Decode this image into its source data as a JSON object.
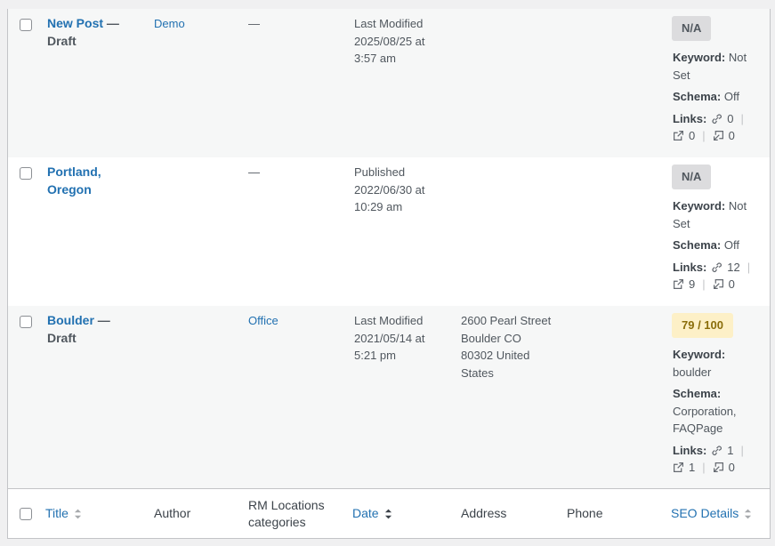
{
  "rows": [
    {
      "title": "New Post",
      "state": "Draft",
      "author": "Demo",
      "categories": "—",
      "date_line1": "Last Modified",
      "date_line2": "2025/08/25 at",
      "date_line3": "3:57 am",
      "address": [
        "",
        "",
        "",
        ""
      ],
      "phone": "",
      "seo_badge": "N/A",
      "keyword_label": "Keyword:",
      "keyword_value": "Not Set",
      "schema_label": "Schema:",
      "schema_value": "Off",
      "links_label": "Links:",
      "links_internal": "0",
      "links_external": "0",
      "links_incoming": "0"
    },
    {
      "title": "Portland, Oregon",
      "state": "",
      "author": "",
      "categories": "—",
      "date_line1": "Published",
      "date_line2": "2022/06/30 at",
      "date_line3": "10:29 am",
      "address": [
        "",
        "",
        "",
        ""
      ],
      "phone": "",
      "seo_badge": "N/A",
      "keyword_label": "Keyword:",
      "keyword_value": "Not Set",
      "schema_label": "Schema:",
      "schema_value": "Off",
      "links_label": "Links:",
      "links_internal": "12",
      "links_external": "9",
      "links_incoming": "0"
    },
    {
      "title": "Boulder",
      "state": "Draft",
      "author": "",
      "categories": "Office",
      "date_line1": "Last Modified",
      "date_line2": "2021/05/14 at",
      "date_line3": "5:21 pm",
      "address": [
        "2600 Pearl Street",
        "Boulder CO",
        "80302 United",
        "States"
      ],
      "phone": "",
      "seo_badge": "79 / 100",
      "keyword_label": "Keyword:",
      "keyword_value": "boulder",
      "schema_label": "Schema:",
      "schema_value": "Corporation, FAQPage",
      "links_label": "Links:",
      "links_internal": "1",
      "links_external": "1",
      "links_incoming": "0"
    }
  ],
  "footer": {
    "title": "Title",
    "author": "Author",
    "categories": "RM Locations categories",
    "date": "Date",
    "address": "Address",
    "phone": "Phone",
    "seo": "SEO Details"
  },
  "colors": {
    "link": "#2271b1",
    "badge_na_bg": "#dcdcde",
    "badge_score_bg": "#fdf0c7",
    "badge_score_text": "#8a6d0b"
  }
}
